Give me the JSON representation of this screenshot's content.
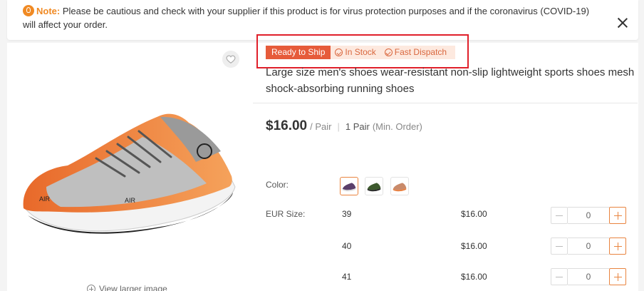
{
  "notice": {
    "icon": "lightbulb-icon",
    "label": "Note:",
    "text": " Please be cautious and check with your supplier if this product is for virus protection purposes and if the coronavirus (COVID-19) will affect your order."
  },
  "product": {
    "badges": {
      "ready": "Ready to Ship",
      "in_stock": "In Stock",
      "fast_dispatch": "Fast Dispatch"
    },
    "title": "Large size men's shoes wear-resistant non-slip lightweight sports shoes mesh shock-absorbing running shoes",
    "price": "$16.00",
    "price_unit": "/ Pair",
    "moq": "1 Pair",
    "moq_note": "(Min. Order)",
    "view_larger": "View larger image"
  },
  "options": {
    "color_label": "Color:",
    "size_label": "EUR Size:",
    "sizes": [
      {
        "size": "39",
        "price": "$16.00",
        "qty": "0"
      },
      {
        "size": "40",
        "price": "$16.00",
        "qty": "0"
      },
      {
        "size": "41",
        "price": "$16.00",
        "qty": "0"
      }
    ]
  },
  "colors": {
    "accent": "#e9843f",
    "badge": "#e65b3a",
    "highlight_box": "#e0202a"
  }
}
